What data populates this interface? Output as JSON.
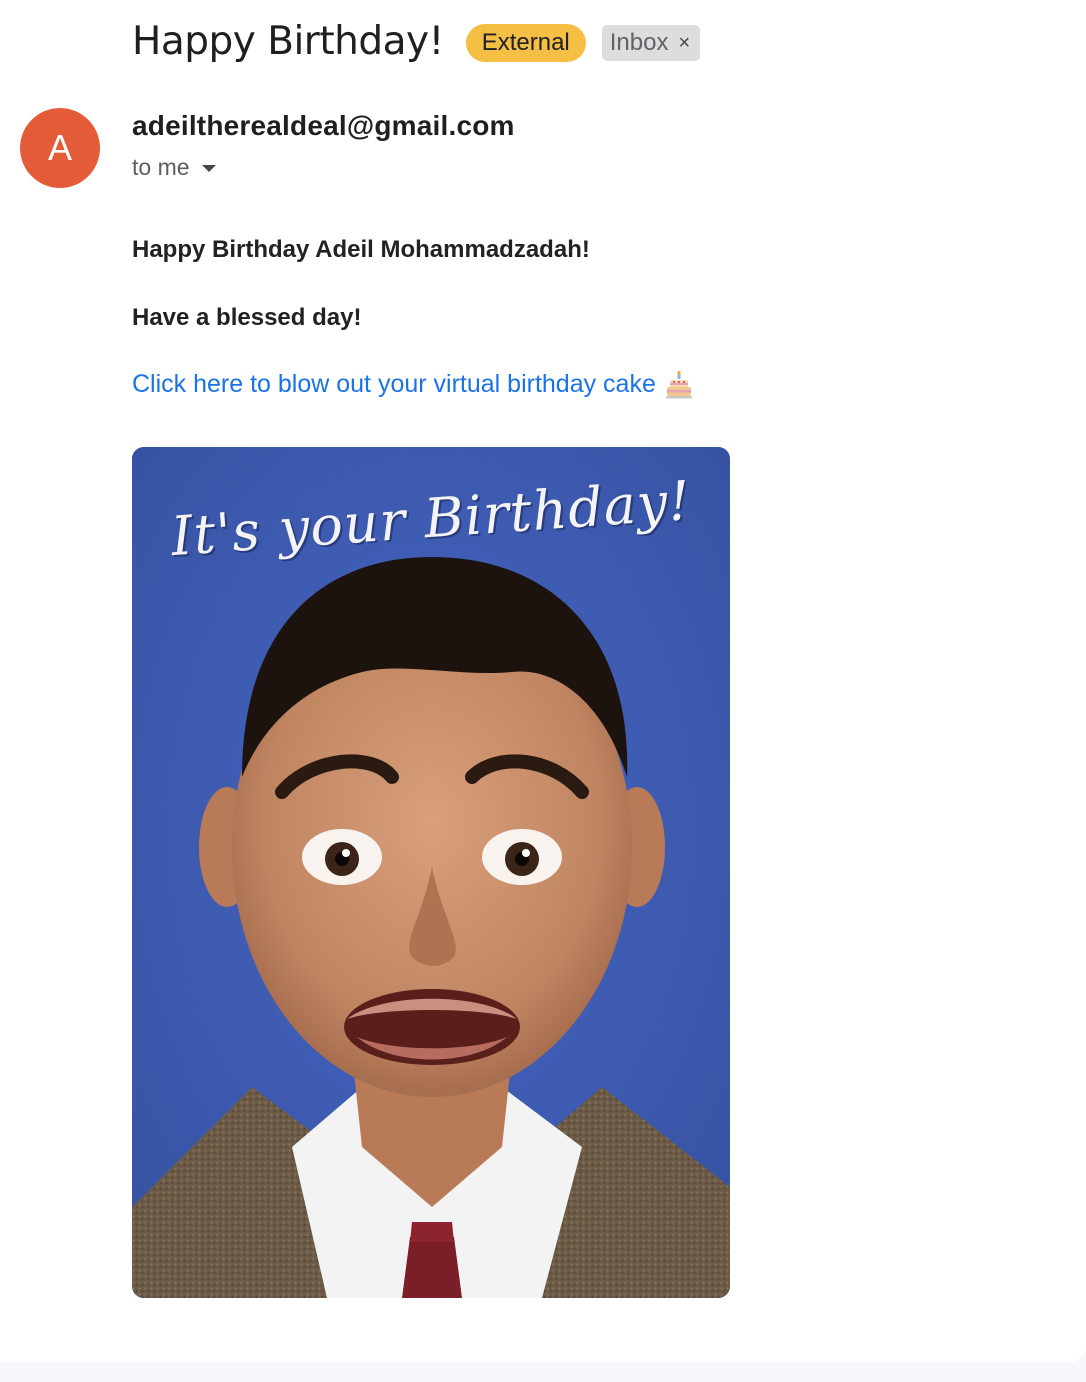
{
  "subject": "Happy Birthday!",
  "labels": {
    "external": "External",
    "inbox": "Inbox",
    "remove_symbol": "×"
  },
  "sender": {
    "avatar_letter": "A",
    "avatar_color": "#e35b37",
    "email": "adeiltherealdeal@gmail.com",
    "recipient": "to me"
  },
  "body": {
    "greeting": "Happy Birthday Adeil Mohammadzadah!",
    "wish": "Have a blessed day!",
    "link_text": "Click here to blow out your virtual birthday cake",
    "link_icon": "birthday-cake-icon",
    "link_color": "#1a73e8"
  },
  "image": {
    "caption": "It's your Birthday!",
    "background_color": "#3f5bb8"
  }
}
